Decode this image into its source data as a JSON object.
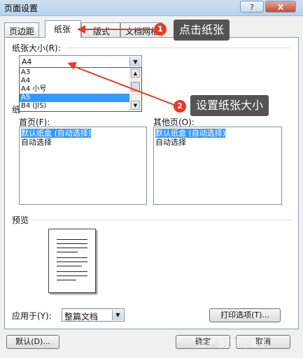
{
  "window": {
    "title": "页面设置",
    "help_label": "?",
    "close_label": "X"
  },
  "tabs": [
    {
      "label": "页边距"
    },
    {
      "label": "纸张"
    },
    {
      "label": "版式"
    },
    {
      "label": "文档网格"
    }
  ],
  "paper_size": {
    "label": "纸张大小(R):",
    "value": "A4",
    "options": [
      "A3",
      "A4",
      "A4 小号",
      "A5",
      "B4 (JIS)"
    ],
    "selected_option": "A5"
  },
  "paper_source": {
    "group_label": "纸",
    "first_page_label": "首页(F):",
    "other_pages_label": "其他页(O):",
    "first_page_items": [
      "默认纸盒 (自动选择)",
      "自动选择"
    ],
    "other_pages_items": [
      "默认纸盒 (自动选择)",
      "自动选择"
    ],
    "first_page_selected": "默认纸盒 (自动选择)",
    "other_pages_selected": "默认纸盒 (自动选择)"
  },
  "preview": {
    "label": "预览"
  },
  "apply_to": {
    "label": "应用于(Y):",
    "value": "整篇文档"
  },
  "buttons": {
    "print_options": "打印选项(T)...",
    "default": "默认(D)...",
    "ok": "确定",
    "cancel": "取消"
  },
  "annotations": {
    "step1_number": "1",
    "step1_text": "点击纸张",
    "step2_number": "2",
    "step2_text": "设置纸张大小",
    "accent_color": "#e53a2a"
  },
  "watermark": "知乎 @打印小助手"
}
